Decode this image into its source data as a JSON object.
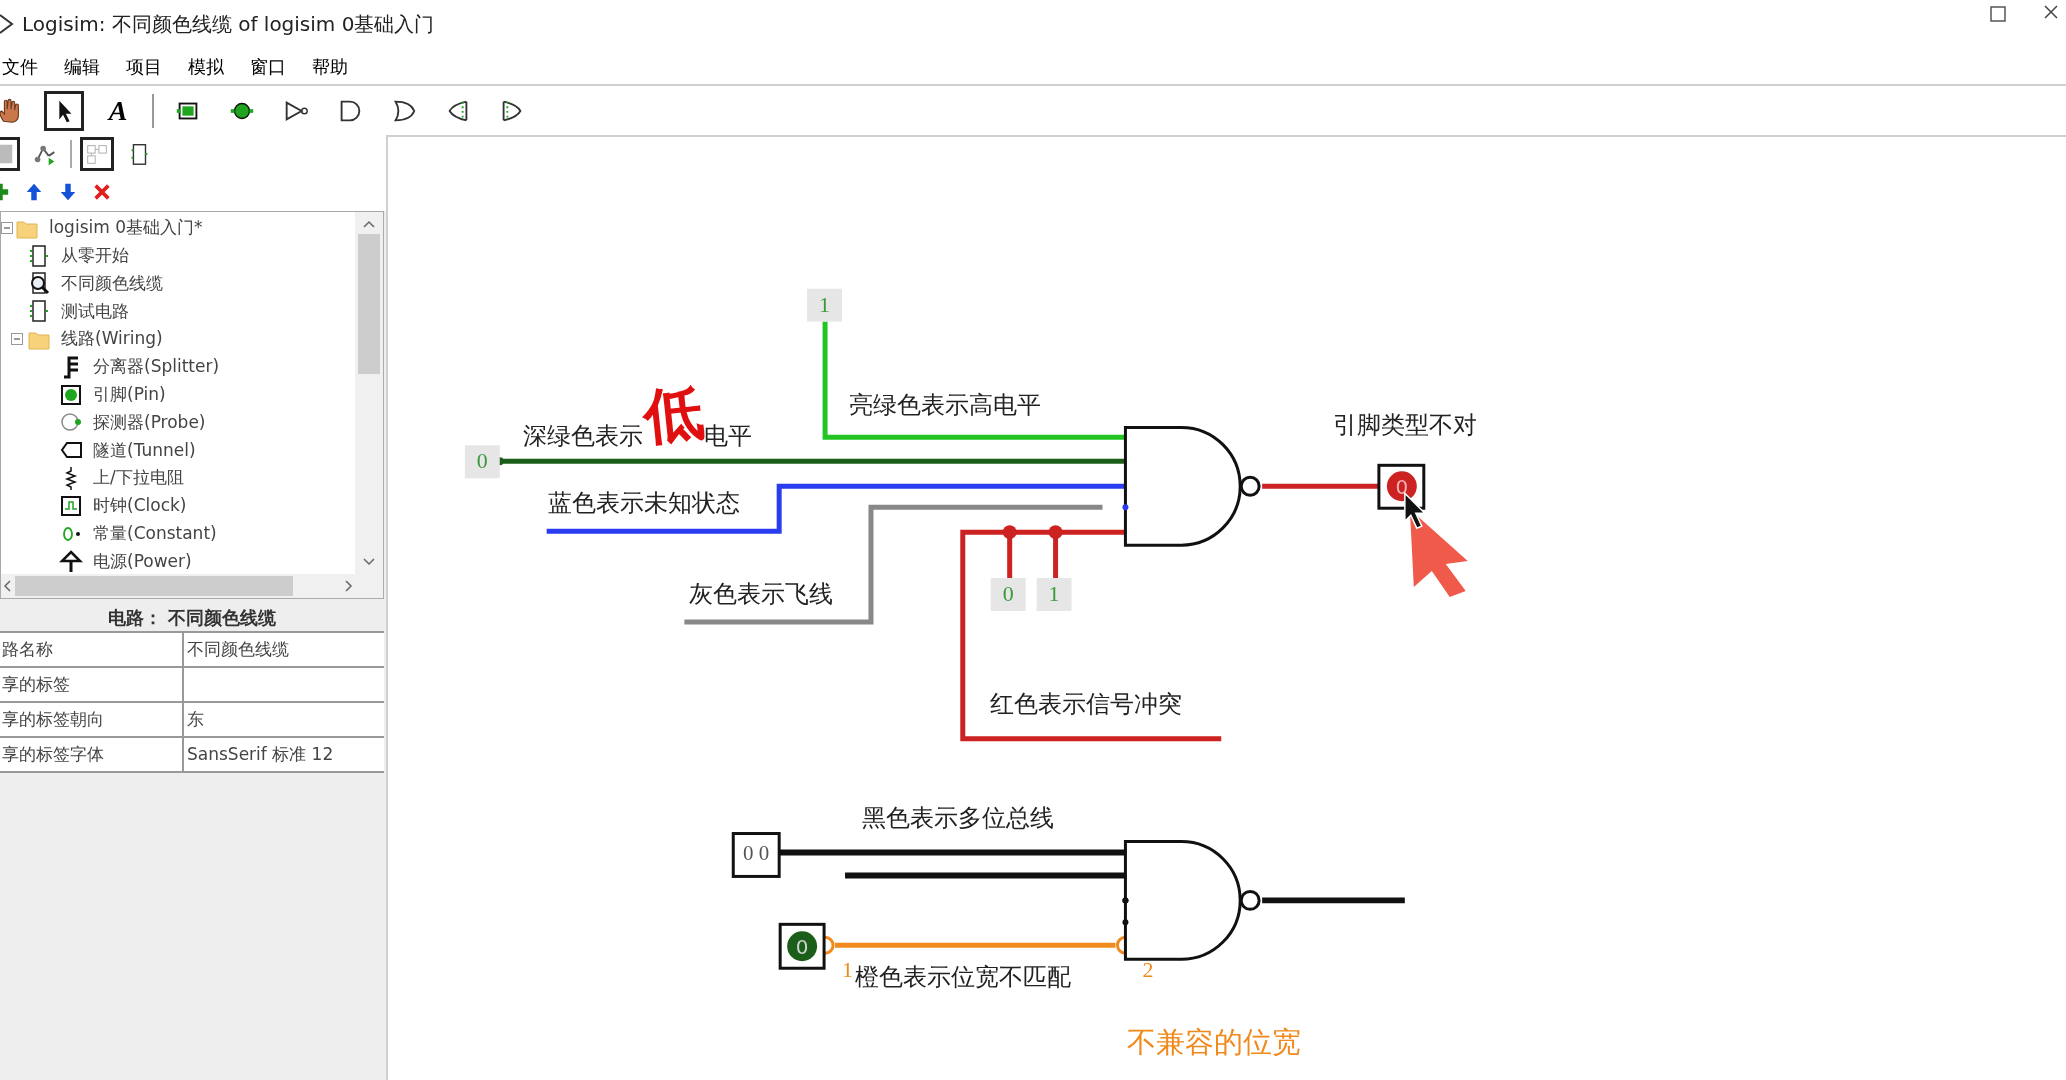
{
  "window": {
    "title": "Logisim: 不同颜色线缆 of logisim 0基础入门"
  },
  "menu": [
    "文件",
    "编辑",
    "项目",
    "模拟",
    "窗口",
    "帮助"
  ],
  "toolbar": {
    "tools": [
      {
        "kind": "poke",
        "selected": false
      },
      {
        "kind": "select",
        "selected": true
      },
      {
        "kind": "text",
        "glyph": "A",
        "selected": false
      },
      {
        "kind": "separator"
      },
      {
        "kind": "input_pin",
        "selected": false
      },
      {
        "kind": "output_pin",
        "selected": false
      },
      {
        "kind": "not_gate",
        "selected": false
      },
      {
        "kind": "and_gate",
        "selected": false
      },
      {
        "kind": "or_gate",
        "selected": false
      },
      {
        "kind": "left_gate",
        "selected": false
      },
      {
        "kind": "right_gate",
        "selected": false
      }
    ]
  },
  "project_toolbar": [
    {
      "kind": "toolbox",
      "selected": true
    },
    {
      "kind": "simulation",
      "selected": false
    },
    {
      "kind": "layout",
      "selected": true
    },
    {
      "kind": "appearance",
      "selected": false
    }
  ],
  "circuit_buttons": [
    {
      "kind": "add"
    },
    {
      "kind": "up"
    },
    {
      "kind": "down"
    },
    {
      "kind": "remove"
    }
  ],
  "tree": {
    "label": "logisim 0基础入门*",
    "kind": "folder",
    "expanded": true,
    "children": [
      {
        "label": "从零开始",
        "kind": "circuit"
      },
      {
        "label": "不同颜色线缆",
        "kind": "circuit_open"
      },
      {
        "label": "测试电路",
        "kind": "circuit"
      },
      {
        "label": "线路(Wiring)",
        "kind": "folder",
        "expanded": true,
        "children": [
          {
            "label": "分离器(Splitter)",
            "kind": "splitter"
          },
          {
            "label": "引脚(Pin)",
            "kind": "pin"
          },
          {
            "label": "探测器(Probe)",
            "kind": "probe"
          },
          {
            "label": "隧道(Tunnel)",
            "kind": "tunnel"
          },
          {
            "label": "上/下拉电阻",
            "kind": "resistor"
          },
          {
            "label": "时钟(Clock)",
            "kind": "clock"
          },
          {
            "label": "常量(Constant)",
            "kind": "constant"
          },
          {
            "label": "电源(Power)",
            "kind": "power"
          }
        ]
      }
    ]
  },
  "properties": {
    "header": "电路： 不同颜色线缆",
    "rows": [
      {
        "name": "路名称",
        "value": "不同颜色线缆"
      },
      {
        "name": "享的标签"
      },
      {
        "name": "享的标签朝向",
        "value": "东"
      },
      {
        "name": "享的标签字体",
        "value": "SansSerif 标准 12"
      }
    ]
  },
  "canvas": {
    "constants": [
      {
        "value": "1"
      },
      {
        "value": "0"
      },
      {
        "value": "0"
      },
      {
        "value": "1"
      }
    ],
    "wires": [
      {
        "kind": "high",
        "label": "亮绿色表示高电平"
      },
      {
        "kind": "low",
        "label": "深绿色表示",
        "label_end": "电平"
      },
      {
        "kind": "unknown",
        "label": "蓝色表示未知状态"
      },
      {
        "kind": "floating",
        "label": "灰色表示飞线"
      },
      {
        "kind": "error",
        "label": "红色表示信号冲突"
      },
      {
        "kind": "bus",
        "label": "黑色表示多位总线"
      },
      {
        "kind": "mismatch",
        "label": "橙色表示位宽不匹配"
      }
    ],
    "output_pin": {
      "value": "0",
      "label": "引脚类型不对"
    },
    "bus_pin": {
      "value": "0 0"
    },
    "input_pin": {
      "value": "0"
    },
    "width_marks": [
      "1",
      "2"
    ],
    "error_message": "不兼容的位宽",
    "annotation": "低"
  }
}
